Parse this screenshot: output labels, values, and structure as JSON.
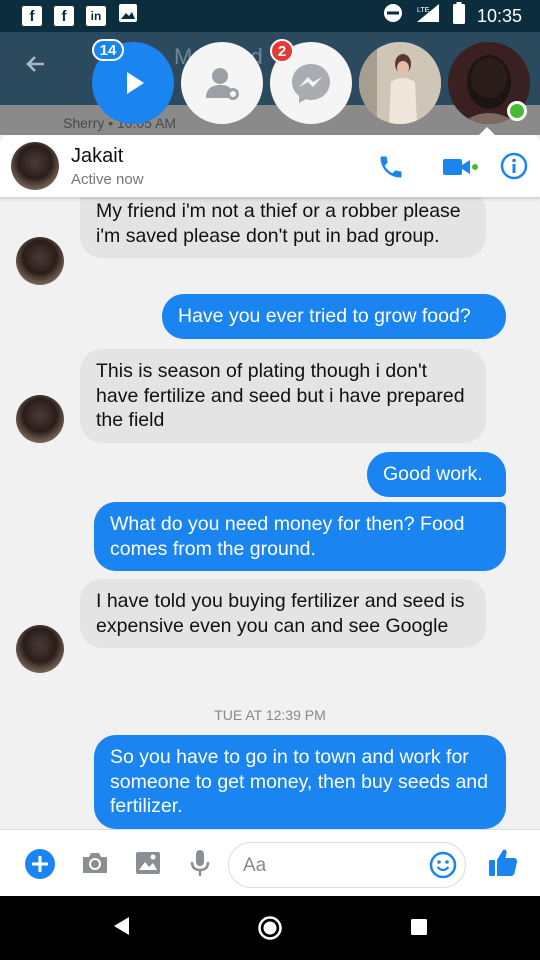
{
  "status_bar": {
    "time": "10:35",
    "network": "LTE",
    "left_icons": [
      "facebook-icon",
      "facebook-icon",
      "linkedin-icon",
      "image-icon"
    ],
    "right_icons": [
      "do-not-disturb-icon",
      "lte-signal-icon",
      "battery-icon"
    ]
  },
  "chat_heads": [
    {
      "name": "play-head",
      "badge": "14"
    },
    {
      "name": "person-head",
      "badge": ""
    },
    {
      "name": "messenger-head",
      "badge": "2"
    },
    {
      "name": "photo-head",
      "badge": ""
    },
    {
      "name": "active-contact-head",
      "badge": ""
    }
  ],
  "behind": {
    "title_fragment": "M d",
    "subtitle": "Sherry • 10:05 AM"
  },
  "conversation": {
    "contact_name": "Jakait",
    "status": "Active now",
    "accent": "#1a85f0"
  },
  "messages": [
    {
      "side": "in",
      "text": "My friend i'm not a thief or a robber please i'm saved please don't put in bad group."
    },
    {
      "side": "out",
      "text": "Have you ever tried to grow food?"
    },
    {
      "side": "in",
      "text": "This is season of plating though i don't have fertilize and seed but i have prepared the field"
    },
    {
      "side": "out",
      "text": "Good work."
    },
    {
      "side": "out",
      "text": "What do you need money for then? Food comes from the ground."
    },
    {
      "side": "in",
      "text": "I have told you buying fertilizer and seed is expensive even you can and see Google"
    },
    {
      "side": "out",
      "text": "So you have to go in to town and work for someone to get money, then buy seeds and fertilizer."
    }
  ],
  "timestamp": "TUE AT 12:39 PM",
  "composer": {
    "placeholder": "Aa",
    "value": ""
  }
}
